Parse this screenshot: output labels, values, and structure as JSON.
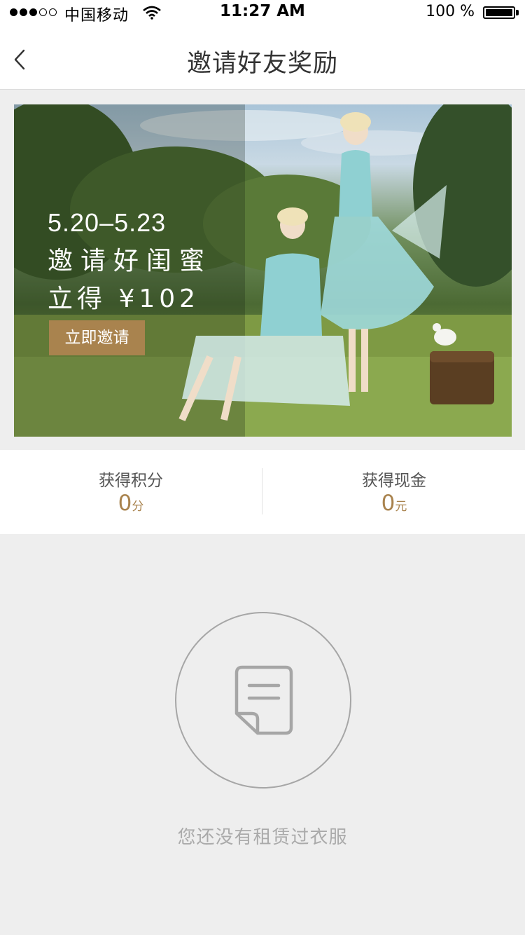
{
  "status_bar": {
    "carrier": "中国移动",
    "time": "11:27 AM",
    "battery": "100 %"
  },
  "nav": {
    "title": "邀请好友奖励",
    "back_icon": "chevron-left-icon"
  },
  "banner": {
    "date_range": "5.20–5.23",
    "line1": "邀请好闺蜜",
    "line2": "立得 ¥102",
    "button_label": "立即邀请",
    "accent_color": "#a9834e"
  },
  "stats": {
    "points": {
      "label": "获得积分",
      "value": "0",
      "unit": "分"
    },
    "cash": {
      "label": "获得现金",
      "value": "0",
      "unit": "元"
    }
  },
  "empty_state": {
    "icon": "document-icon",
    "message": "您还没有租赁过衣服"
  }
}
